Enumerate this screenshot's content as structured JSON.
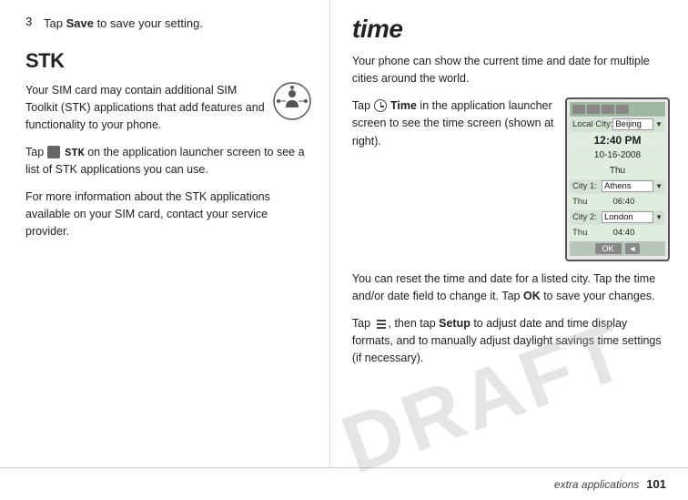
{
  "left": {
    "step3": {
      "number": "3",
      "text": "Tap ",
      "keyword": "Save",
      "text2": " to save your setting."
    },
    "stk": {
      "title": "STK",
      "description": "Your SIM card may contain additional SIM Toolkit (STK) applications that add features and functionality to your phone.",
      "para1_prefix": "Tap ",
      "para1_icon": "STK icon",
      "para1_keyword": "STK",
      "para1_suffix": " on the application launcher screen to see a list of STK applications you can use.",
      "para2": "For more information about the STK applications available on your SIM card, contact your service provider."
    }
  },
  "right": {
    "title": "time",
    "para1": "Your phone can show the current time and date for multiple cities around the world.",
    "para2_prefix": "Tap ",
    "para2_time_label": "Time",
    "para2_suffix": " in the application launcher screen to see the time screen (shown at right).",
    "para3": "You can reset the time and date for a listed city. Tap the time and/or date field to change it. Tap ",
    "para3_keyword": "OK",
    "para3_suffix": " to save your changes.",
    "para4_prefix": "Tap ",
    "para4_menu": "menu",
    "para4_middle": ", then tap ",
    "para4_keyword": "Setup",
    "para4_suffix": " to adjust date and time display formats, and to manually adjust daylight savings time settings (if necessary)."
  },
  "screen": {
    "local_city_label": "Local City:",
    "local_city_value": "Beijing",
    "time_value": "12:40 PM",
    "date_value": "10-16-2008",
    "day_value": "Thu",
    "city1_label": "City 1:",
    "city1_value": "Athens",
    "city1_time": "06:40",
    "city1_day": "Thu",
    "city2_label": "City 2:",
    "city2_value": "London",
    "city2_time": "04:40",
    "city2_day": "Thu",
    "ok_btn": "OK"
  },
  "footer": {
    "section": "extra applications",
    "page_number": "101"
  },
  "watermark": "DRAFT"
}
